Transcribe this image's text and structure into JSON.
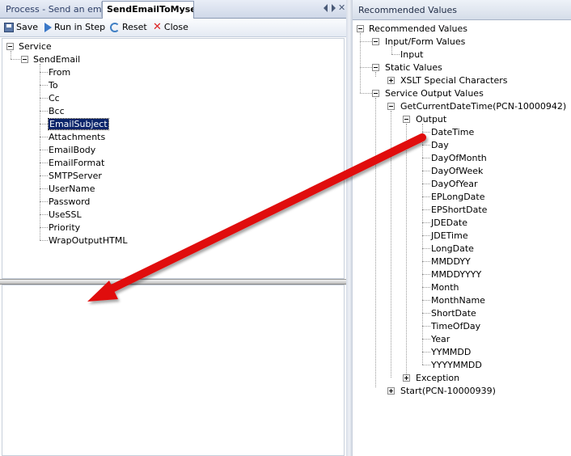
{
  "tabs": {
    "process": "Process - Send an email",
    "active": "SendEmailToMyself",
    "close_glyph": "✕"
  },
  "toolbar": {
    "save": "Save",
    "run": "Run in Step",
    "reset": "Reset",
    "close": "Close"
  },
  "left_tree": {
    "root": "Service",
    "child": "SendEmail",
    "selected_index": 4,
    "fields": [
      "From",
      "To",
      "Cc",
      "Bcc",
      "EmailSubject",
      "Attachments",
      "EmailBody",
      "EmailFormat",
      "SMTPServer",
      "UserName",
      "Password",
      "UseSSL",
      "Priority",
      "WrapOutputHTML"
    ]
  },
  "right_panel": {
    "header": "Recommended Values",
    "root": "Recommended Values",
    "input_form": "Input/Form Values",
    "input": "Input",
    "static_values": "Static Values",
    "xslt": "XSLT Special Characters",
    "service_output": "Service Output Values",
    "get_current": "GetCurrentDateTime(PCN-10000942)",
    "output": "Output",
    "output_fields": [
      "DateTime",
      "Day",
      "DayOfMonth",
      "DayOfWeek",
      "DayOfYear",
      "EPLongDate",
      "EPShortDate",
      "JDEDate",
      "JDETime",
      "LongDate",
      "MMDDYY",
      "MMDDYYYY",
      "Month",
      "MonthName",
      "ShortDate",
      "TimeOfDay",
      "Year",
      "YYMMDD",
      "YYYYMMDD"
    ],
    "exception": "Exception",
    "start": "Start(PCN-10000939)"
  },
  "annotation": {
    "arrow_color": "#e01010"
  }
}
